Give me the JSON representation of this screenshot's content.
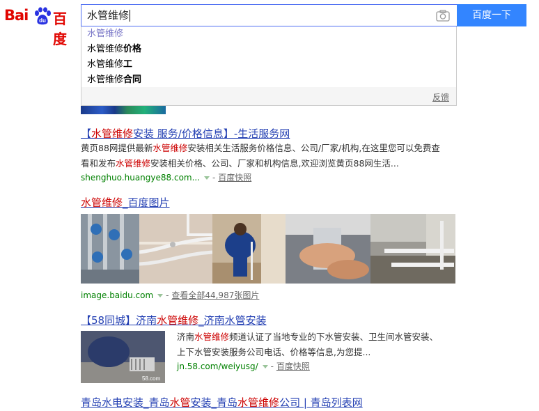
{
  "logo": {
    "bai": "Bai",
    "du": "du",
    "cn": "百度"
  },
  "search": {
    "query": "水管维修",
    "button_label": "百度一下"
  },
  "suggestions": [
    {
      "prefix": "水管维修",
      "suffix": ""
    },
    {
      "prefix": "水管维修",
      "suffix": "价格"
    },
    {
      "prefix": "水管维修",
      "suffix": "工"
    },
    {
      "prefix": "水管维修",
      "suffix": "合同"
    }
  ],
  "suggest_footer": {
    "feedback": "反馈"
  },
  "results": {
    "r1": {
      "title_pre": "【",
      "title_em": "水管维修",
      "title_post": "安装 服务/价格信息】-生活服务网",
      "abs_line1_a": "黄页88网提供最新",
      "abs_line1_em": "水管维修",
      "abs_line1_b": "安装相关生活服务价格信息、公司/厂家/机构,在这里您可以免费查",
      "abs_line2_a": "看和发布",
      "abs_line2_em": "水管维修",
      "abs_line2_b": "安装相关价格、公司、厂家和机构信息,欢迎浏览黄页88网生活...",
      "url": "shenghuo.huangye88.com...",
      "sep": "-",
      "snapshot": "百度快照"
    },
    "r2": {
      "title_em": "水管维修",
      "title_post": "_百度图片",
      "url": "image.baidu.com",
      "sep": "-",
      "view_all": "查看全部44,987张图片"
    },
    "r3": {
      "title_pre": "【58同城】济南",
      "title_em": "水管维修",
      "title_post": "_济南水管安装",
      "abs_line1_a": "济南",
      "abs_line1_em": "水管维修",
      "abs_line1_b": "频道认证了当地专业的下水管安装、卫生间水管安装、",
      "abs_line2": "上下水管安装服务公司电话、价格等信息,为您提...",
      "url": "jn.58.com/weiyusg/",
      "sep": "-",
      "snapshot": "百度快照",
      "thumb_watermark": "58.com"
    },
    "r4": {
      "title_a": "青岛水电安装_青岛",
      "title_em1": "水管",
      "title_b": "安装_青岛",
      "title_em2": "水管维修",
      "title_c": "公司 | 青岛列表网"
    }
  }
}
